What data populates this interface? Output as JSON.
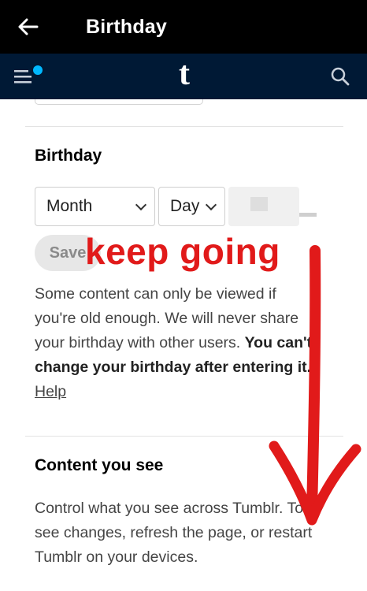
{
  "appbar": {
    "title": "Birthday",
    "back_icon": "arrow-left-icon"
  },
  "tumblr_bar": {
    "menu_icon": "menu-icon",
    "logo": "t",
    "search_icon": "search-icon",
    "notification_color": "#00b8ff"
  },
  "birthday": {
    "heading": "Birthday",
    "month_select": "Month",
    "day_select": "Day",
    "save_label": "Save",
    "description_part1": "Some content can only be viewed if you're old enough. We will never share your birthday with other users. ",
    "description_bold": "You can't change your birthday after entering it.",
    "help_link": "Help"
  },
  "content_you_see": {
    "heading": "Content you see",
    "description": "Control what you see across Tumblr. To see changes, refresh the page, or restart Tumblr on your devices."
  },
  "annotation": {
    "text": "keep going",
    "color": "#e11a1a"
  }
}
